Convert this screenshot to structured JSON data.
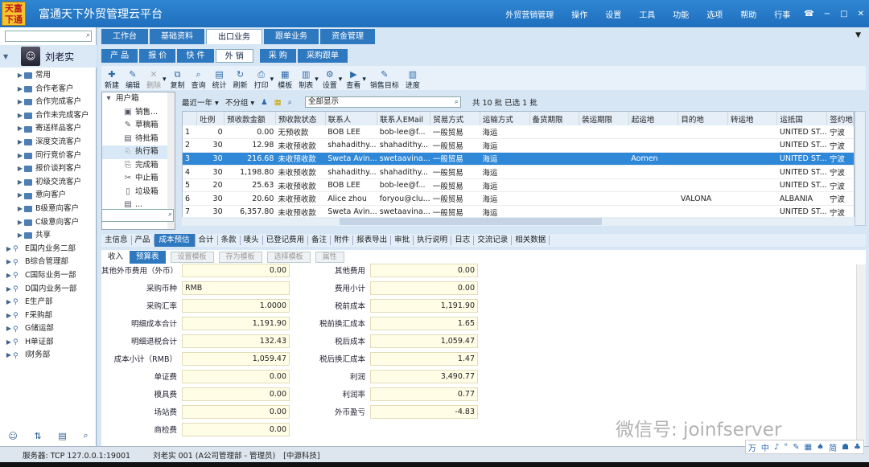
{
  "app": {
    "logo_text": "天富下通",
    "title": "富通天下外贸管理云平台",
    "header_items": [
      "外贸营销管理",
      "操作",
      "设置",
      "工具",
      "功能",
      "选项",
      "帮助",
      "行事"
    ],
    "window_controls": [
      "☎",
      "−",
      "□",
      "✕"
    ]
  },
  "left": {
    "user_name": "刘老实",
    "tree": [
      {
        "label": "常用",
        "type": "folder"
      },
      {
        "label": "合作老客户",
        "type": "folder"
      },
      {
        "label": "合作完成客户",
        "type": "folder"
      },
      {
        "label": "合作未完成客户",
        "type": "folder"
      },
      {
        "label": "寄送样品客户",
        "type": "folder"
      },
      {
        "label": "深度交流客户",
        "type": "folder"
      },
      {
        "label": "同行竞价客户",
        "type": "folder"
      },
      {
        "label": "报价谈判客户",
        "type": "folder"
      },
      {
        "label": "初级交流客户",
        "type": "folder"
      },
      {
        "label": "意向客户",
        "type": "folder"
      },
      {
        "label": "B级意向客户",
        "type": "folder"
      },
      {
        "label": "C级意向客户",
        "type": "folder"
      },
      {
        "label": "共享",
        "type": "folder"
      },
      {
        "label": "E国内业务二部",
        "type": "org"
      },
      {
        "label": "B综合管理部",
        "type": "org"
      },
      {
        "label": "C国际业务一部",
        "type": "org"
      },
      {
        "label": "D国内业务一部",
        "type": "org"
      },
      {
        "label": "E生产部",
        "type": "org"
      },
      {
        "label": "F采购部",
        "type": "org"
      },
      {
        "label": "G储运部",
        "type": "org"
      },
      {
        "label": "H单证部",
        "type": "org"
      },
      {
        "label": "I财务部",
        "type": "org"
      }
    ]
  },
  "main": {
    "top_tabs": [
      "工作台",
      "基础资料",
      "出口业务",
      "跟单业务",
      "资金管理"
    ],
    "active_top": "出口业务",
    "sub_tabs": [
      "产 品",
      "报 价",
      "快 件",
      "外 销",
      "采 购",
      "采购跟单"
    ],
    "active_sub": "外 销",
    "toolbar": [
      {
        "label": "新建",
        "icon": "new-icon",
        "glyph": "✚"
      },
      {
        "label": "编辑",
        "icon": "edit-icon",
        "glyph": "✎"
      },
      {
        "label": "删除",
        "icon": "delete-icon",
        "glyph": "✕",
        "disabled": true
      },
      {
        "label": "复制",
        "icon": "copy-icon",
        "glyph": "⧉"
      },
      {
        "label": "查询",
        "icon": "query-icon",
        "glyph": "⌕"
      },
      {
        "label": "统计",
        "icon": "stats-icon",
        "glyph": "▤"
      },
      {
        "label": "刷新",
        "icon": "refresh-icon",
        "glyph": "↻"
      },
      {
        "label": "打印",
        "icon": "print-icon",
        "glyph": "⎙"
      },
      {
        "label": "模板",
        "icon": "template-icon",
        "glyph": "▦"
      },
      {
        "label": "制表",
        "icon": "table-icon",
        "glyph": "▥"
      },
      {
        "label": "设置",
        "icon": "settings-icon",
        "glyph": "⚙"
      },
      {
        "label": "查看",
        "icon": "view-icon",
        "glyph": "▶"
      },
      {
        "label": "销售目标",
        "icon": "target-icon",
        "glyph": "✎"
      },
      {
        "label": "进度",
        "icon": "progress-icon",
        "glyph": "▥"
      }
    ],
    "folders": [
      {
        "label": "用户箱",
        "glyph": "▾"
      },
      {
        "label": "销售...",
        "glyph": "▣"
      },
      {
        "label": "草稿箱",
        "glyph": "✎"
      },
      {
        "label": "待批箱",
        "glyph": "▤"
      },
      {
        "label": "执行箱",
        "glyph": "♘"
      },
      {
        "label": "完成箱",
        "glyph": "⎘"
      },
      {
        "label": "中止箱",
        "glyph": "✂"
      },
      {
        "label": "垃圾箱",
        "glyph": "▯"
      },
      {
        "label": "...",
        "glyph": "▤"
      }
    ],
    "filter": {
      "period": "最近一年",
      "group": "不分组",
      "show": "全部显示",
      "summary": "共 10 批  已选 1 批"
    },
    "grid": {
      "columns": [
        "",
        "吐例",
        "预收款金额",
        "预收款状态",
        "联系人",
        "联系人EMail",
        "贸易方式",
        "运输方式",
        "备货期限",
        "装运期限",
        "起运地",
        "目的地",
        "转运地",
        "运抵国",
        "签约地"
      ],
      "rows": [
        [
          "1",
          "0",
          "0.00",
          "无预收款",
          "BOB LEE",
          "bob-lee@f...",
          "一般贸易",
          "海运",
          "",
          "",
          "",
          "",
          "",
          "UNITED ST...",
          "宁波"
        ],
        [
          "2",
          "30",
          "12.98",
          "未收预收款",
          "shahadithy...",
          "shahadithy...",
          "一般贸易",
          "海运",
          "",
          "",
          "",
          "",
          "",
          "UNITED ST...",
          "宁波"
        ],
        [
          "3",
          "30",
          "216.68",
          "未收预收款",
          "Sweta Avin...",
          "swetaavina...",
          "一般贸易",
          "海运",
          "",
          "",
          "Aomen",
          "",
          "",
          "UNITED ST...",
          "宁波"
        ],
        [
          "4",
          "30",
          "1,198.80",
          "未收预收款",
          "shahadithy...",
          "shahadithy...",
          "一般贸易",
          "海运",
          "",
          "",
          "",
          "",
          "",
          "UNITED ST...",
          "宁波"
        ],
        [
          "5",
          "20",
          "25.63",
          "未收预收款",
          "BOB LEE",
          "bob-lee@f...",
          "一般贸易",
          "海运",
          "",
          "",
          "",
          "",
          "",
          "UNITED ST...",
          "宁波"
        ],
        [
          "6",
          "30",
          "20.60",
          "未收预收款",
          "Alice zhou",
          "foryou@clu...",
          "一般贸易",
          "海运",
          "",
          "",
          "",
          "VALONA",
          "",
          "ALBANIA",
          "宁波"
        ],
        [
          "7",
          "30",
          "6,357.80",
          "未收预收款",
          "Sweta Avin...",
          "swetaavina...",
          "一般贸易",
          "海运",
          "",
          "",
          "",
          "",
          "",
          "UNITED ST...",
          "宁波"
        ]
      ],
      "selected_index": 2
    },
    "lower_tabs": [
      "主信息",
      "产品",
      "成本预估",
      "合计",
      "条款",
      "唛头",
      "已登记费用",
      "备注",
      "附件",
      "报表导出",
      "审批",
      "执行说明",
      "日志",
      "交流记录",
      "相关数据"
    ],
    "active_lower": "成本预估",
    "lower_sub": [
      "收入",
      "预算表"
    ],
    "active_lower_sub": "预算表",
    "lower_buttons": [
      "设置模板",
      "存为模板",
      "选择模板",
      "属性"
    ],
    "form_left": [
      {
        "label": "其他外币费用（外币）",
        "value": "0.00"
      },
      {
        "label": "采购币种",
        "value": "RMB"
      },
      {
        "label": "采购汇率",
        "value": "1.0000"
      },
      {
        "label": "明细成本合计",
        "value": "1,191.90"
      },
      {
        "label": "明细退税合计",
        "value": "132.43"
      },
      {
        "label": "成本小计（RMB）",
        "value": "1,059.47"
      },
      {
        "label": "单证费",
        "value": "0.00"
      },
      {
        "label": "模具费",
        "value": "0.00"
      },
      {
        "label": "场站费",
        "value": "0.00"
      },
      {
        "label": "商检费",
        "value": "0.00"
      }
    ],
    "form_right": [
      {
        "label": "其他费用",
        "value": "0.00"
      },
      {
        "label": "费用小计",
        "value": "0.00"
      },
      {
        "label": "税前成本",
        "value": "1,191.90"
      },
      {
        "label": "税前换汇成本",
        "value": "1.65"
      },
      {
        "label": "税后成本",
        "value": "1,059.47"
      },
      {
        "label": "税后换汇成本",
        "value": "1.47"
      },
      {
        "label": "利润",
        "value": "3,490.77"
      },
      {
        "label": "利润率",
        "value": "0.77"
      },
      {
        "label": "外币盈亏",
        "value": "-4.83"
      }
    ]
  },
  "watermark": "微信号: joinfserver",
  "status": {
    "server": "服务器: TCP  127.0.0.1:19001",
    "user": "刘老实 001 (A公司管理部 - 管理员)",
    "company": "[中源科技]"
  },
  "ime": [
    "万",
    "中",
    "♪",
    "°",
    "✎",
    "▦",
    "♠",
    "简",
    "☗",
    "♣"
  ]
}
